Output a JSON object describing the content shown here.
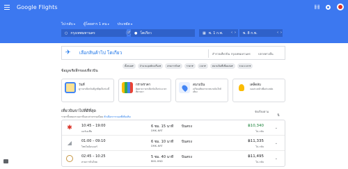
{
  "app": {
    "title": "Google Flights"
  },
  "header": {
    "apps_icon": "apps-grid-icon",
    "settings_icon": "gear-icon",
    "avatar_icon": "avatar-icon"
  },
  "search": {
    "trip_type": "ไป-กลับ",
    "passengers": "ผู้โดยสาร 1 คน",
    "cabin": "ประหยัด",
    "origin": "กรุงเทพมหานคร",
    "destination": "โตเกียว",
    "depart": "พ. 1 ก.พ.",
    "return": "พ. 8 ก.พ."
  },
  "explore": {
    "title": "เลือกสินค้าไป โตเกียว",
    "link1": "สำรวจเที่ยวบิน กรุงเทพมหานคร",
    "link2": "ปลายทางอื่น"
  },
  "filters": {
    "title": "ข้อมูลเชิงลึกของเที่ยวบิน",
    "chips": [
      "ทั้งหมด",
      "จำนวนจุดพักเครื่อง",
      "สายการบิน",
      "ราคา",
      "เวลา",
      "สนามบินที่เชื่อมต่อ",
      "ระยะเวลา"
    ]
  },
  "insights": [
    {
      "title": "วันที่",
      "desc": "ดูราคาเที่ยวบินที่ถูกที่สุดในช่วงนี้"
    },
    {
      "title": "กราฟราคา",
      "desc": "ติดตามราคาเที่ยวบินในช่วงเวลาที่ผ่านมา"
    },
    {
      "title": "สนามบิน",
      "desc": "เปรียบเทียบราคาสนามบินใกล้เคียง"
    },
    {
      "title": "เคล็ดลับ",
      "desc": "จองล่วงหน้าเพื่อประหยัด"
    }
  ],
  "results": {
    "title": "เที่ยวบินขาไปที่ดีที่สุด",
    "note_prefix": "ราคาทั้งหมดรวมภาษีและค่าธรรมเนียม",
    "note_link": "ตัวเลือกการจองที่เพิ่มเติม",
    "sort_label": "จัดเรียงตาม",
    "flights": [
      {
        "times": "10:45 – 19:00",
        "airline": "แอร์เอเชีย",
        "duration": "6 ชม. 15 นาที",
        "route": "DMK–NRT",
        "stops": "บินตรง",
        "price": "฿10,340",
        "price_type": "ไป-กลับ",
        "logo": "airasia-logo-icon"
      },
      {
        "times": "01:00 – 09:10",
        "airline": "ไทยไลอ้อนแอร์",
        "duration": "6 ชม. 10 นาที",
        "route": "DMK–NRT",
        "stops": "บินตรง",
        "price": "฿11,335",
        "price_type": "ไป-กลับ",
        "logo": "thai-lion-air-logo-icon"
      },
      {
        "times": "02:45 – 10:25",
        "airline": "สายการบินไทย",
        "duration": "5 ชม. 40 นาที",
        "route": "BKK–HND",
        "stops": "บินตรง",
        "price": "฿11,495",
        "price_type": "ไป-กลับ",
        "logo": "thai-airways-logo-icon"
      }
    ]
  },
  "colors": {
    "brand": "#3c78f0",
    "link": "#1a73e8",
    "price_low": "#188038"
  }
}
